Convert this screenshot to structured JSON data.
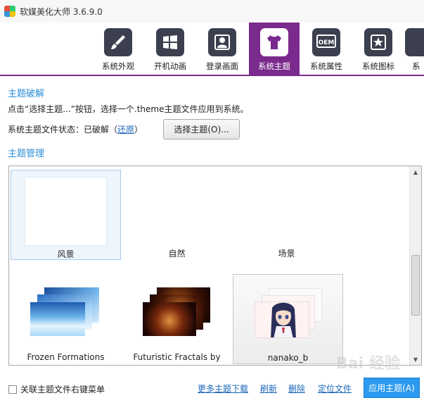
{
  "window": {
    "title": "软媒美化大师 3.6.9.0"
  },
  "toolbar": {
    "items": [
      {
        "label": "系统外观",
        "icon": "brush-icon"
      },
      {
        "label": "开机动画",
        "icon": "windows-logo-icon"
      },
      {
        "label": "登录画面",
        "icon": "user-icon"
      },
      {
        "label": "系统主题",
        "icon": "tshirt-icon"
      },
      {
        "label": "系统属性",
        "icon": "oem-icon"
      },
      {
        "label": "系统图标",
        "icon": "star-icon"
      },
      {
        "label": "系",
        "icon": "partial-icon"
      }
    ],
    "active_index": 3,
    "accent_color": "#7a2a8c",
    "oem_text": "OEM"
  },
  "theme_crack": {
    "title": "主题破解",
    "description": "点击“选择主题...”按钮，选择一个.theme主题文件应用到系统。",
    "status_prefix": "系统主题文件状态：已破解（",
    "restore_link": "还原",
    "status_suffix": "）",
    "choose_button": "选择主题(O)..."
  },
  "theme_manage": {
    "title": "主题管理",
    "themes": [
      {
        "name": "风景",
        "state": "selected"
      },
      {
        "name": "自然",
        "state": "normal"
      },
      {
        "name": "场景",
        "state": "normal"
      },
      {
        "name": "Frozen Formations",
        "state": "normal"
      },
      {
        "name": "Futuristic Fractals by",
        "state": "normal"
      },
      {
        "name": "nanako_b",
        "state": "hover"
      }
    ]
  },
  "footer": {
    "checkbox_label": "关联主题文件右键菜单",
    "checkbox_checked": false,
    "links": [
      "更多主题下载",
      "刷新",
      "删除",
      "定位文件"
    ],
    "apply_button": "应用主题(A)"
  },
  "watermark": "Bai 经验"
}
